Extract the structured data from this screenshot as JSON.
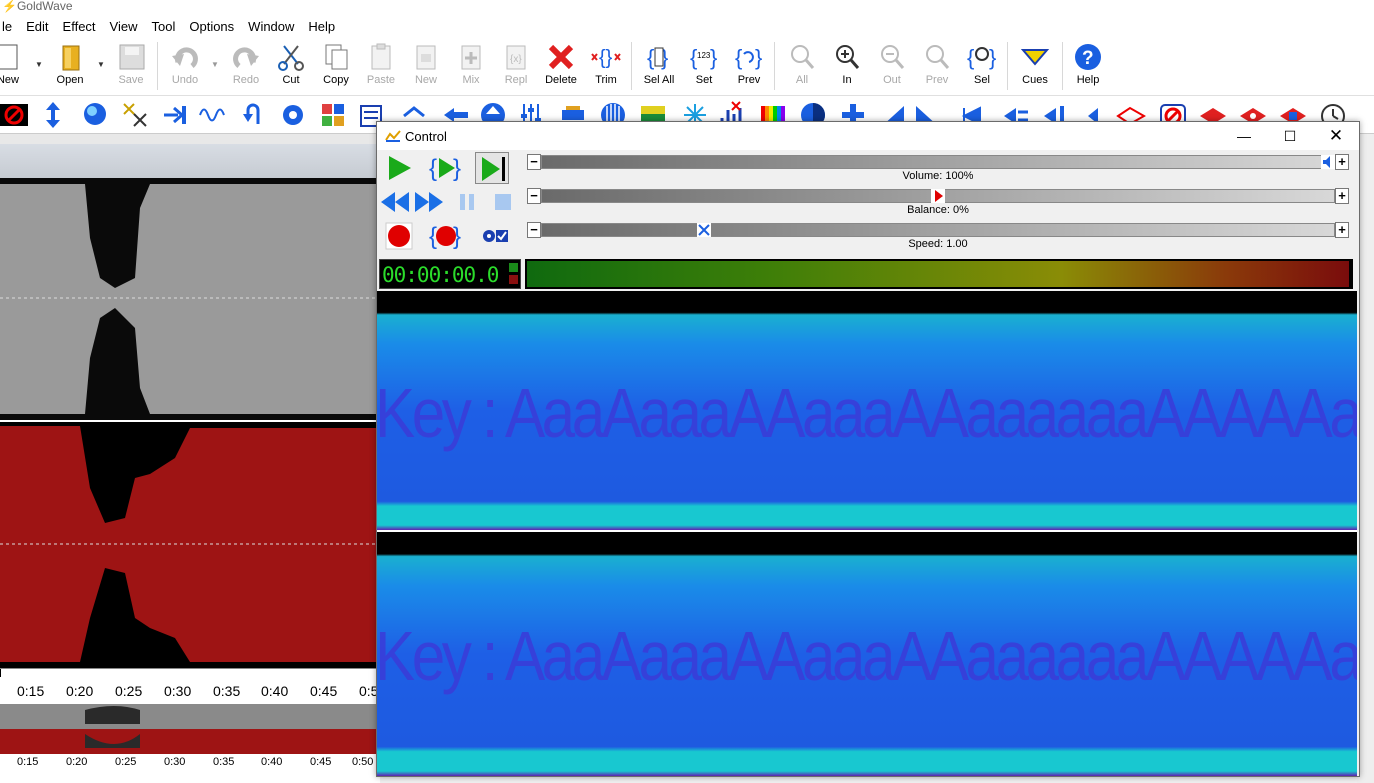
{
  "app": {
    "title": "GoldWave"
  },
  "menu": [
    "le",
    "Edit",
    "Effect",
    "View",
    "Tool",
    "Options",
    "Window",
    "Help"
  ],
  "toolbar": [
    {
      "label": "New",
      "enabled": true
    },
    {
      "label": "Open",
      "enabled": true
    },
    {
      "label": "Save",
      "enabled": false
    },
    {
      "label": "Undo",
      "enabled": false
    },
    {
      "label": "Redo",
      "enabled": false
    },
    {
      "label": "Cut",
      "enabled": true
    },
    {
      "label": "Copy",
      "enabled": true
    },
    {
      "label": "Paste",
      "enabled": false
    },
    {
      "label": "New",
      "enabled": false
    },
    {
      "label": "Mix",
      "enabled": false
    },
    {
      "label": "Repl",
      "enabled": false
    },
    {
      "label": "Delete",
      "enabled": true
    },
    {
      "label": "Trim",
      "enabled": true
    },
    {
      "label": "Sel All",
      "enabled": true
    },
    {
      "label": "Set",
      "enabled": true
    },
    {
      "label": "Prev",
      "enabled": true
    },
    {
      "label": "All",
      "enabled": false
    },
    {
      "label": "In",
      "enabled": true
    },
    {
      "label": "Out",
      "enabled": false
    },
    {
      "label": "Prev",
      "enabled": false
    },
    {
      "label": "Sel",
      "enabled": true
    },
    {
      "label": "Cues",
      "enabled": true
    },
    {
      "label": "Help",
      "enabled": true
    }
  ],
  "timeline": {
    "ticks": [
      "0:15",
      "0:20",
      "0:25",
      "0:30",
      "0:35",
      "0:40",
      "0:45",
      "0:5"
    ]
  },
  "overview_timeline": {
    "ticks": [
      "0:15",
      "0:20",
      "0:25",
      "0:30",
      "0:35",
      "0:40",
      "0:45",
      "0:50"
    ]
  },
  "control": {
    "title": "Control",
    "volume_label": "Volume: 100%",
    "volume": 1.0,
    "balance_label": "Balance: 0%",
    "balance": 0.5,
    "speed_label": "Speed: 1.00",
    "speed": 0.2,
    "time": "00:00:00.0",
    "spectrogram_text": "Key : AaaAaaaAAaaaAAaaaaaaAAAAAaaaaaaa!",
    "colors": {
      "play": "#1aaa1a",
      "record": "#e00000",
      "spectro_bg": "#1e5fe6",
      "time_fg": "#2bdc2b"
    }
  }
}
